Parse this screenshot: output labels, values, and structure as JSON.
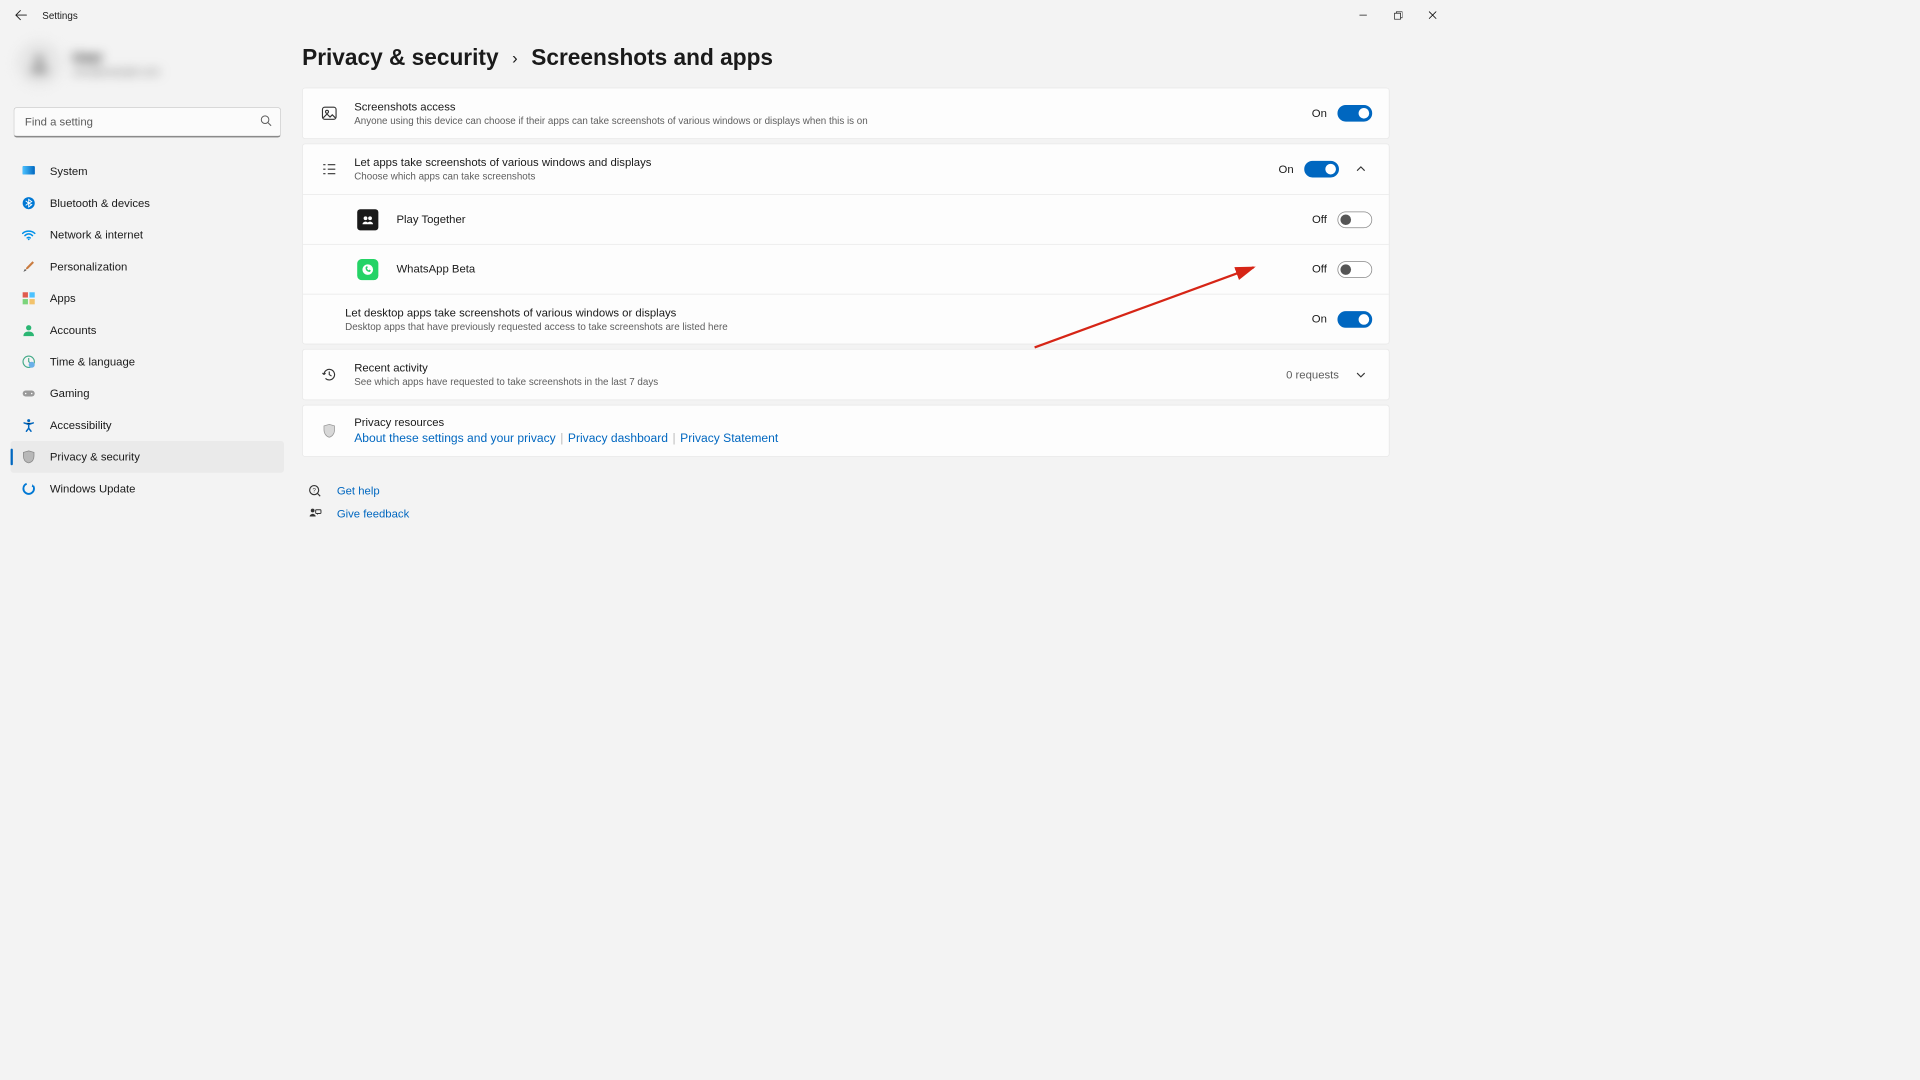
{
  "window": {
    "title": "Settings"
  },
  "account": {
    "name": "User",
    "email": "user@example.com"
  },
  "search": {
    "placeholder": "Find a setting"
  },
  "sidebar": {
    "items": [
      {
        "label": "System"
      },
      {
        "label": "Bluetooth & devices"
      },
      {
        "label": "Network & internet"
      },
      {
        "label": "Personalization"
      },
      {
        "label": "Apps"
      },
      {
        "label": "Accounts"
      },
      {
        "label": "Time & language"
      },
      {
        "label": "Gaming"
      },
      {
        "label": "Accessibility"
      },
      {
        "label": "Privacy & security"
      },
      {
        "label": "Windows Update"
      }
    ],
    "active_index": 9
  },
  "breadcrumb": {
    "parent": "Privacy & security",
    "current": "Screenshots and apps"
  },
  "rows": {
    "screenshots_access": {
      "title": "Screenshots access",
      "sub": "Anyone using this device can choose if their apps can take screenshots of various windows or displays when this is on",
      "state": "On",
      "on": true
    },
    "let_apps": {
      "title": "Let apps take screenshots of various windows and displays",
      "sub": "Choose which apps can take screenshots",
      "state": "On",
      "on": true,
      "expanded": true
    },
    "app1": {
      "name": "Play Together",
      "state": "Off",
      "on": false
    },
    "app2": {
      "name": "WhatsApp Beta",
      "state": "Off",
      "on": false
    },
    "let_desktop": {
      "title": "Let desktop apps take screenshots of various windows or displays",
      "sub": "Desktop apps that have previously requested access to take screenshots are listed here",
      "state": "On",
      "on": true
    },
    "recent": {
      "title": "Recent activity",
      "sub": "See which apps have requested to take screenshots in the last 7 days",
      "requests": "0 requests"
    },
    "resources": {
      "title": "Privacy resources",
      "link1": "About these settings and your privacy",
      "link2": "Privacy dashboard",
      "link3": "Privacy Statement"
    }
  },
  "footer": {
    "help": "Get help",
    "feedback": "Give feedback"
  }
}
